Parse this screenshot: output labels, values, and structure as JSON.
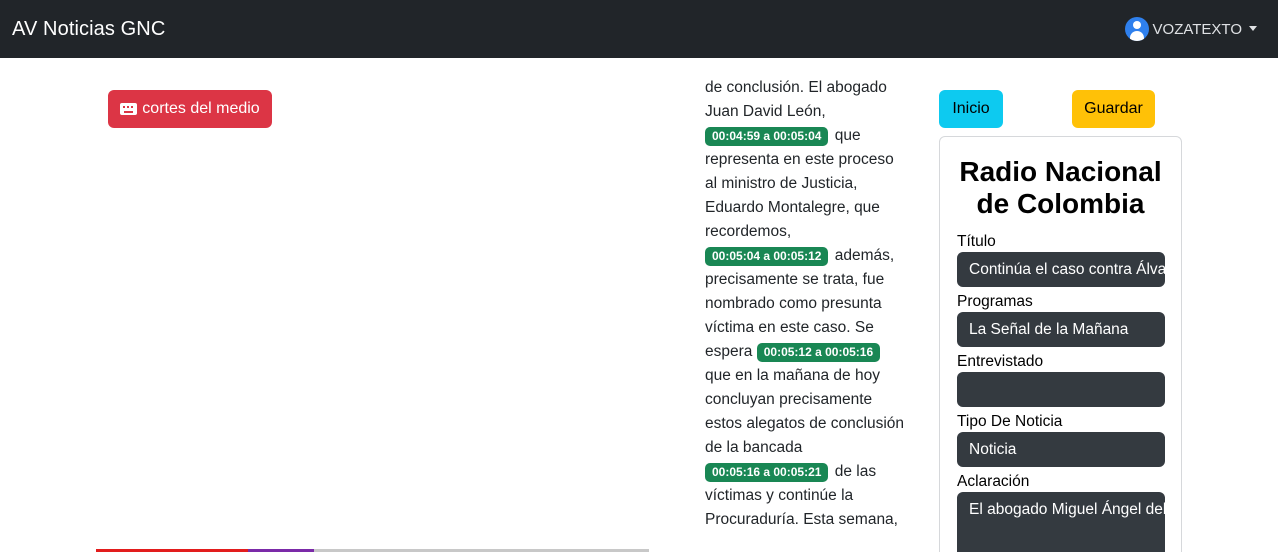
{
  "navbar": {
    "brand": "AV Noticias GNC",
    "user": "VOZATEXTO"
  },
  "left": {
    "cortes_button": "cortes del medio"
  },
  "transcript": {
    "intro": [
      "de conclusión. El abogado",
      "Juan David León,"
    ],
    "segments": [
      {
        "time": "00:04:59 a 00:05:04",
        "text": "que representa en este proceso al ministro de Justicia, Eduardo Montalegre, que recordemos,"
      },
      {
        "time": "00:05:04 a 00:05:12",
        "text": "además, precisamente se trata, fue nombrado como presunta víctima en este caso. Se espera"
      },
      {
        "time": "00:05:12 a 00:05:16",
        "text": "que en la mañana de hoy concluyan precisamente estos alegatos de conclusión de la bancada"
      },
      {
        "time": "00:05:16 a 00:05:21",
        "text": "de las víctimas y continúe la Procuraduría. Esta semana,"
      }
    ]
  },
  "actions": {
    "inicio": "Inicio",
    "guardar": "Guardar"
  },
  "card": {
    "title": "Radio Nacional de Colombia",
    "fields": {
      "titulo_label": "Título",
      "titulo_value": "Continúa el caso contra Álvaro Uribe",
      "programas_label": "Programas",
      "programas_value": "La Señal de la Mañana",
      "entrevistado_label": "Entrevistado",
      "entrevistado_value": "",
      "tipo_label": "Tipo De Noticia",
      "tipo_value": "Noticia",
      "aclaracion_label": "Aclaración",
      "aclaracion_value": "El abogado Miguel Ángel del Río"
    }
  },
  "colors": {
    "navbar_bg": "#212529",
    "danger": "#dc3545",
    "info": "#0dcaf0",
    "warning": "#ffc107",
    "timestamp": "#198754",
    "field_bg": "#343a40"
  },
  "icons": {
    "user": "user-circle-icon",
    "cortes": "keyboard-icon",
    "dropdown": "caret-down-icon"
  }
}
